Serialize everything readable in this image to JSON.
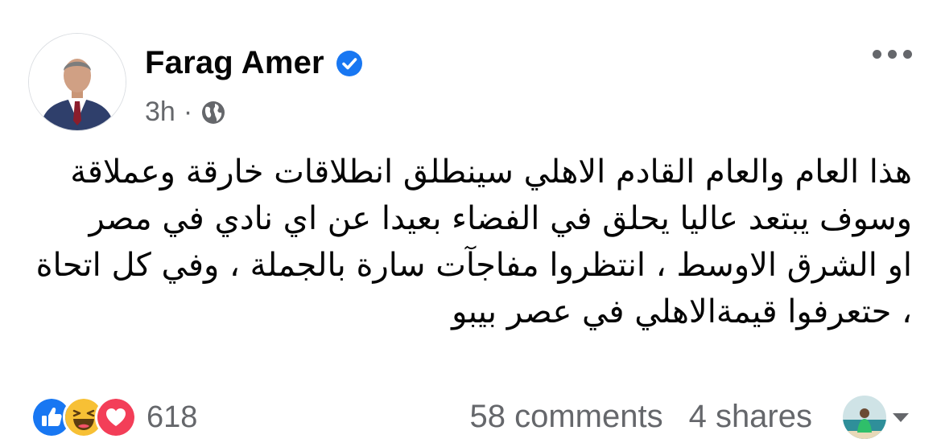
{
  "post": {
    "author": "Farag Amer",
    "time": "3h",
    "separator": "·",
    "text_lines": [
      "هذا العام والعام القادم الاهلي سينطلق انطلاقات خارقة وعملاقة",
      "وسوف يبتعد عاليا يحلق في الفضاء بعيدا عن اي نادي في مصر",
      "او الشرق الاوسط ، انتظروا مفاجآت سارة بالجملة ، وفي كل اتحاة",
      "، حتعرفوا قيمةالاهلي في عصر بيبو"
    ]
  },
  "engagement": {
    "reaction_count": "618",
    "comments": "58 comments",
    "shares": "4 shares"
  },
  "icons": {
    "verified": "verified-badge-icon",
    "audience": "globe-icon",
    "more": "more-options-icon",
    "reactions": [
      "like-icon",
      "haha-icon",
      "love-icon"
    ],
    "dropdown": "chevron-down-icon"
  },
  "colors": {
    "verified": "#1877f2",
    "like": "#1877f2",
    "haha": "#f7c035",
    "love": "#f33e58",
    "secondary_text": "#65676b"
  }
}
